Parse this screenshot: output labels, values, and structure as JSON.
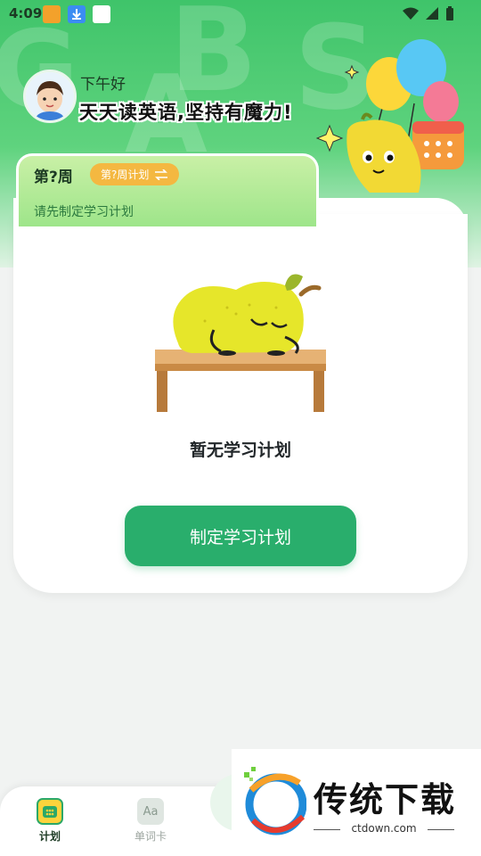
{
  "status_bar": {
    "time": "4:09"
  },
  "header": {
    "greeting": "下午好",
    "slogan": "天天读英语,坚持有魔力!"
  },
  "week": {
    "title": "第?周",
    "switch_label": "第?周计划",
    "hint": "请先制定学习计划"
  },
  "empty_state": {
    "message": "暂无学习计划",
    "button_label": "制定学习计划"
  },
  "bottom_nav": {
    "items": [
      {
        "label": "计划",
        "icon": "calendar-icon",
        "active": true
      },
      {
        "label": "单词卡",
        "icon": "word-card-icon",
        "active": false
      }
    ]
  },
  "watermark": {
    "title": "传统下载",
    "url": "ctdown.com"
  },
  "colors": {
    "primary": "#29ae6c",
    "header_green": "#3fc46a",
    "accent_yellow": "#f4b841"
  }
}
